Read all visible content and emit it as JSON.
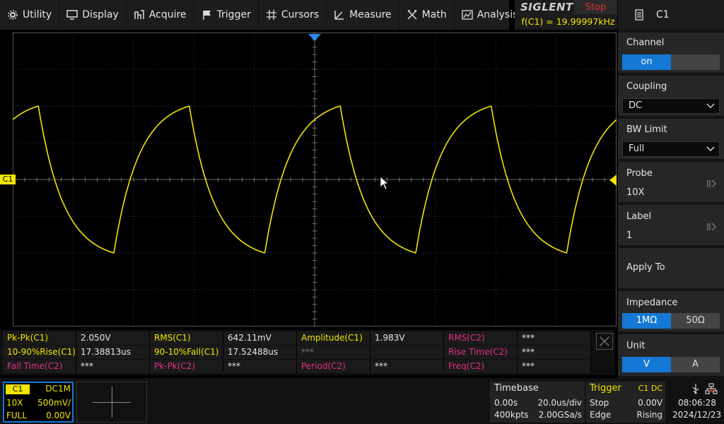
{
  "menu": [
    {
      "label": "Utility",
      "icon": "gear-icon"
    },
    {
      "label": "Display",
      "icon": "monitor-icon"
    },
    {
      "label": "Acquire",
      "icon": "acquire-icon"
    },
    {
      "label": "Trigger",
      "icon": "flag-icon"
    },
    {
      "label": "Cursors",
      "icon": "cursors-icon"
    },
    {
      "label": "Measure",
      "icon": "measure-icon"
    },
    {
      "label": "Math",
      "icon": "math-icon"
    },
    {
      "label": "Analysis",
      "icon": "analysis-icon"
    }
  ],
  "brand": {
    "logo": "SIGLENT",
    "status": "Stop",
    "freq": "f(C1) = 19.99997kHz"
  },
  "panel": {
    "title": "C1",
    "channel": {
      "title": "Channel",
      "on": "on",
      "off": ""
    },
    "coupling": {
      "title": "Coupling",
      "value": "DC"
    },
    "bw_limit": {
      "title": "BW Limit",
      "value": "Full"
    },
    "probe": {
      "title": "Probe",
      "value": "10X"
    },
    "label": {
      "title": "Label",
      "value": "1"
    },
    "apply_to": {
      "title": "Apply To"
    },
    "impedance": {
      "title": "Impedance",
      "opt1": "1MΩ",
      "opt2": "50Ω"
    },
    "unit": {
      "title": "Unit",
      "opt1": "V",
      "opt2": "A"
    }
  },
  "scope": {
    "channel_marker": "C1",
    "trace_color": "#f2e400"
  },
  "waveform": {
    "period_us": 50,
    "timebase_us_per_div": 20,
    "volts_per_div": 0.5,
    "vmax": 1.0,
    "vmin": -1.0
  },
  "measurements": [
    [
      {
        "label": "Pk-Pk(C1)",
        "value": "2.050V",
        "lc": "yel"
      },
      {
        "label": "RMS(C1)",
        "value": "642.11mV",
        "lc": "yel"
      },
      {
        "label": "Amplitude(C1)",
        "value": "1.983V",
        "lc": "yel"
      },
      {
        "label": "RMS(C2)",
        "value": "***",
        "lc": "pink"
      }
    ],
    [
      {
        "label": "10-90%Rise(C1)",
        "value": "17.38813us",
        "lc": "yel"
      },
      {
        "label": "90-10%Fall(C1)",
        "value": "17.52488us",
        "lc": "yel"
      },
      {
        "label": "***",
        "value": "",
        "lc": "grey"
      },
      {
        "label": "Rise Time(C2)",
        "value": "***",
        "lc": "pink"
      }
    ],
    [
      {
        "label": "Fall Time(C2)",
        "value": "***",
        "lc": "pink"
      },
      {
        "label": "Pk-Pk(C2)",
        "value": "***",
        "lc": "pink"
      },
      {
        "label": "Period(C2)",
        "value": "***",
        "lc": "pink"
      },
      {
        "label": "Freq(C2)",
        "value": "***",
        "lc": "pink"
      }
    ]
  ],
  "ch1": {
    "tag": "C1",
    "coupling": "DC1M",
    "probe": "10X",
    "scale": "500mV/",
    "bw": "FULL",
    "offset": "0.00V"
  },
  "timebase": {
    "title": "Timebase",
    "delay": "0.00s",
    "scale": "20.0us/div",
    "points": "400kpts",
    "rate": "2.00GSa/s"
  },
  "trigger": {
    "title": "Trigger",
    "source": "C1 DC",
    "state": "Stop",
    "level": "0.00V",
    "type": "Edge",
    "slope": "Rising"
  },
  "clock": {
    "time": "08:06:28",
    "date": "2024/12/23"
  }
}
